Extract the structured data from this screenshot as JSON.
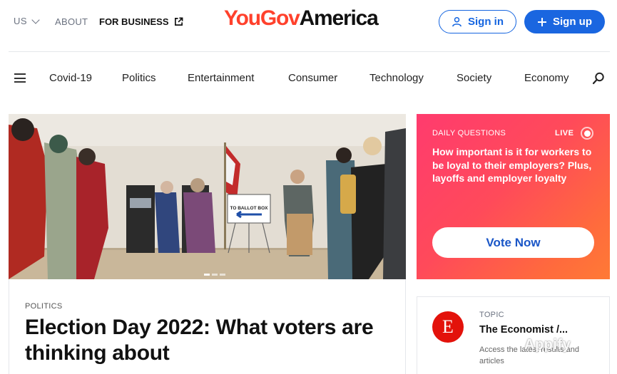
{
  "header": {
    "region": "US",
    "about": "ABOUT",
    "for_business": "FOR BUSINESS",
    "logo_part1": "YouGov",
    "logo_part2": "America",
    "sign_in": "Sign in",
    "sign_up": "Sign up"
  },
  "nav": {
    "items": [
      "Covid-19",
      "Politics",
      "Entertainment",
      "Consumer",
      "Technology",
      "Society",
      "Economy"
    ]
  },
  "hero": {
    "sign_text": "TO BALLOT BOX"
  },
  "article": {
    "category": "POLITICS",
    "title": "Election Day 2022: What voters are thinking about"
  },
  "daily_question": {
    "label": "DAILY QUESTIONS",
    "live": "LIVE",
    "question": "How important is it for workers to be loyal to their employers? Plus, layoffs and employer loyalty",
    "vote_button": "Vote Now"
  },
  "topic": {
    "label": "TOPIC",
    "logo_letter": "E",
    "title": "The Economist /...",
    "description": "Access the latest results and articles"
  },
  "watermark": "Appify",
  "colors": {
    "brand_red": "#ff412c",
    "primary_blue": "#1a66e0",
    "live_gradient_start": "#ff3b6e",
    "live_gradient_end": "#ff7a35",
    "economist_red": "#e3120b"
  },
  "icons": {
    "region_toggle": "chevron-down-icon",
    "external_link": "external-link-icon",
    "sign_in": "user-icon",
    "sign_up": "plus-icon",
    "menu": "hamburger-icon",
    "search": "search-icon"
  }
}
